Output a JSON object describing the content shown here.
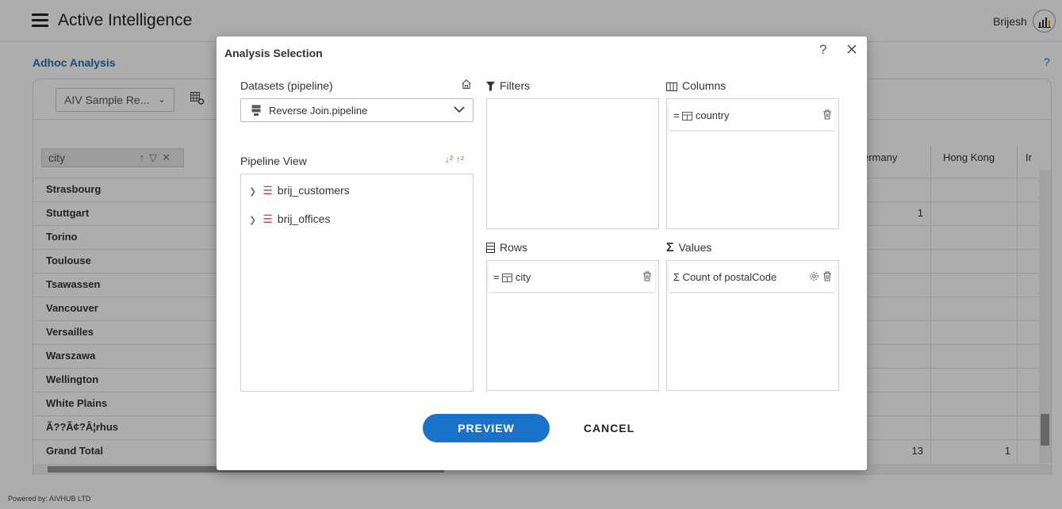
{
  "app": {
    "title": "Active Intelligence",
    "user_name": "Brijesh",
    "footer": "Powered by: AIVHUB LTD"
  },
  "page": {
    "title": "Adhoc Analysis",
    "help": "?",
    "report_select_value": "AIV Sample Re...",
    "city_filter_label": "city"
  },
  "grid": {
    "column_headers": [
      "ermany",
      "Hong Kong",
      "Ir"
    ],
    "rows": [
      "Strasbourg",
      "Stuttgart",
      "Torino",
      "Toulouse",
      "Tsawassen",
      "Vancouver",
      "Versailles",
      "Warszawa",
      "Wellington",
      "White Plains",
      "Ã??Ã¢?Â¦rhus",
      "Grand Total"
    ],
    "stuttgart_germany": "1",
    "grand_total_germany": "13",
    "grand_total_hongkong": "1"
  },
  "modal": {
    "title": "Analysis Selection",
    "help": "?",
    "datasets_label": "Datasets (pipeline)",
    "dataset_value": "Reverse Join.pipeline",
    "pipeline_view_label": "Pipeline View",
    "tree": [
      "brij_customers",
      "brij_offices"
    ],
    "filters_label": "Filters",
    "columns_label": "Columns",
    "rows_label": "Rows",
    "values_label": "Values",
    "column_chip": "country",
    "row_chip": "city",
    "value_chip": "Count of postalCode",
    "preview_label": "PREVIEW",
    "cancel_label": "CANCEL"
  }
}
